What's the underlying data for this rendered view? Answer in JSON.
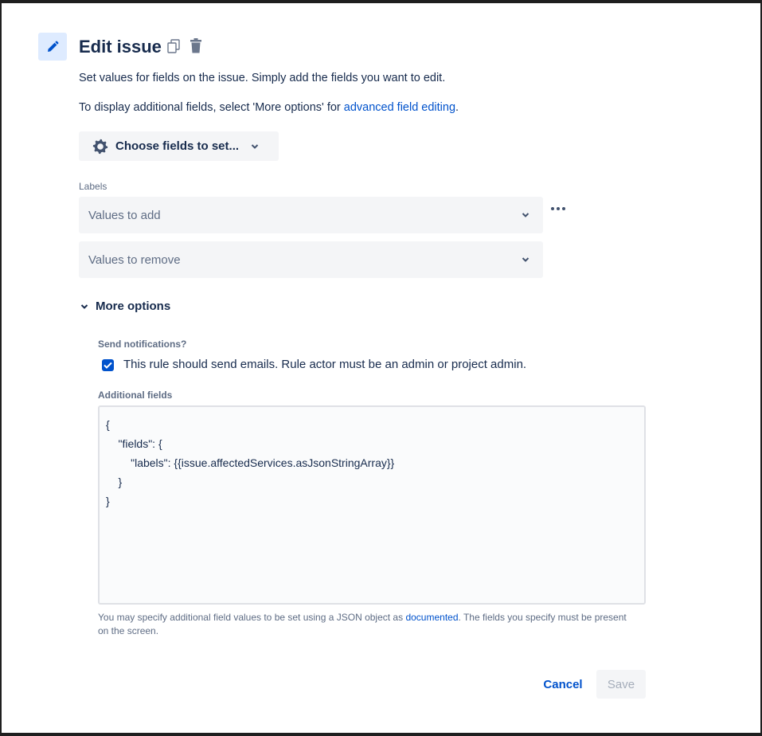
{
  "header": {
    "title": "Edit issue",
    "icons": [
      "pencil-icon",
      "copy-icon",
      "trash-icon"
    ]
  },
  "description": {
    "line1": "Set values for fields on the issue. Simply add the fields you want to edit.",
    "line2_prefix": "To display additional fields, select 'More options' for ",
    "line2_link": "advanced field editing",
    "line2_suffix": "."
  },
  "choose_fields": {
    "label": "Choose fields to set...",
    "icon": "gear-icon",
    "chevron": "chevron-down-icon"
  },
  "labels_field": {
    "label": "Labels",
    "add_placeholder": "Values to add",
    "remove_placeholder": "Values to remove",
    "more_icon": "more-horizontal-icon"
  },
  "more_options": {
    "label": "More options",
    "expanded": true
  },
  "notifications": {
    "label": "Send notifications?",
    "checkbox_label": "This rule should send emails. Rule actor must be an admin or project admin.",
    "checked": true
  },
  "additional_fields": {
    "label": "Additional fields",
    "code_lines": [
      "{",
      "    \"fields\": {",
      "        \"labels\": {{issue.affectedServices.asJsonStringArray}}",
      "    }",
      "}"
    ],
    "help_prefix": "You may specify additional field values to be set using a JSON object as ",
    "help_link": "documented",
    "help_suffix": ". The fields you specify must be present on the screen."
  },
  "footer": {
    "cancel_label": "Cancel",
    "save_label": "Save"
  },
  "colors": {
    "accent": "#0052cc",
    "icon_bg": "#deebff",
    "field_bg": "#f4f5f7"
  }
}
